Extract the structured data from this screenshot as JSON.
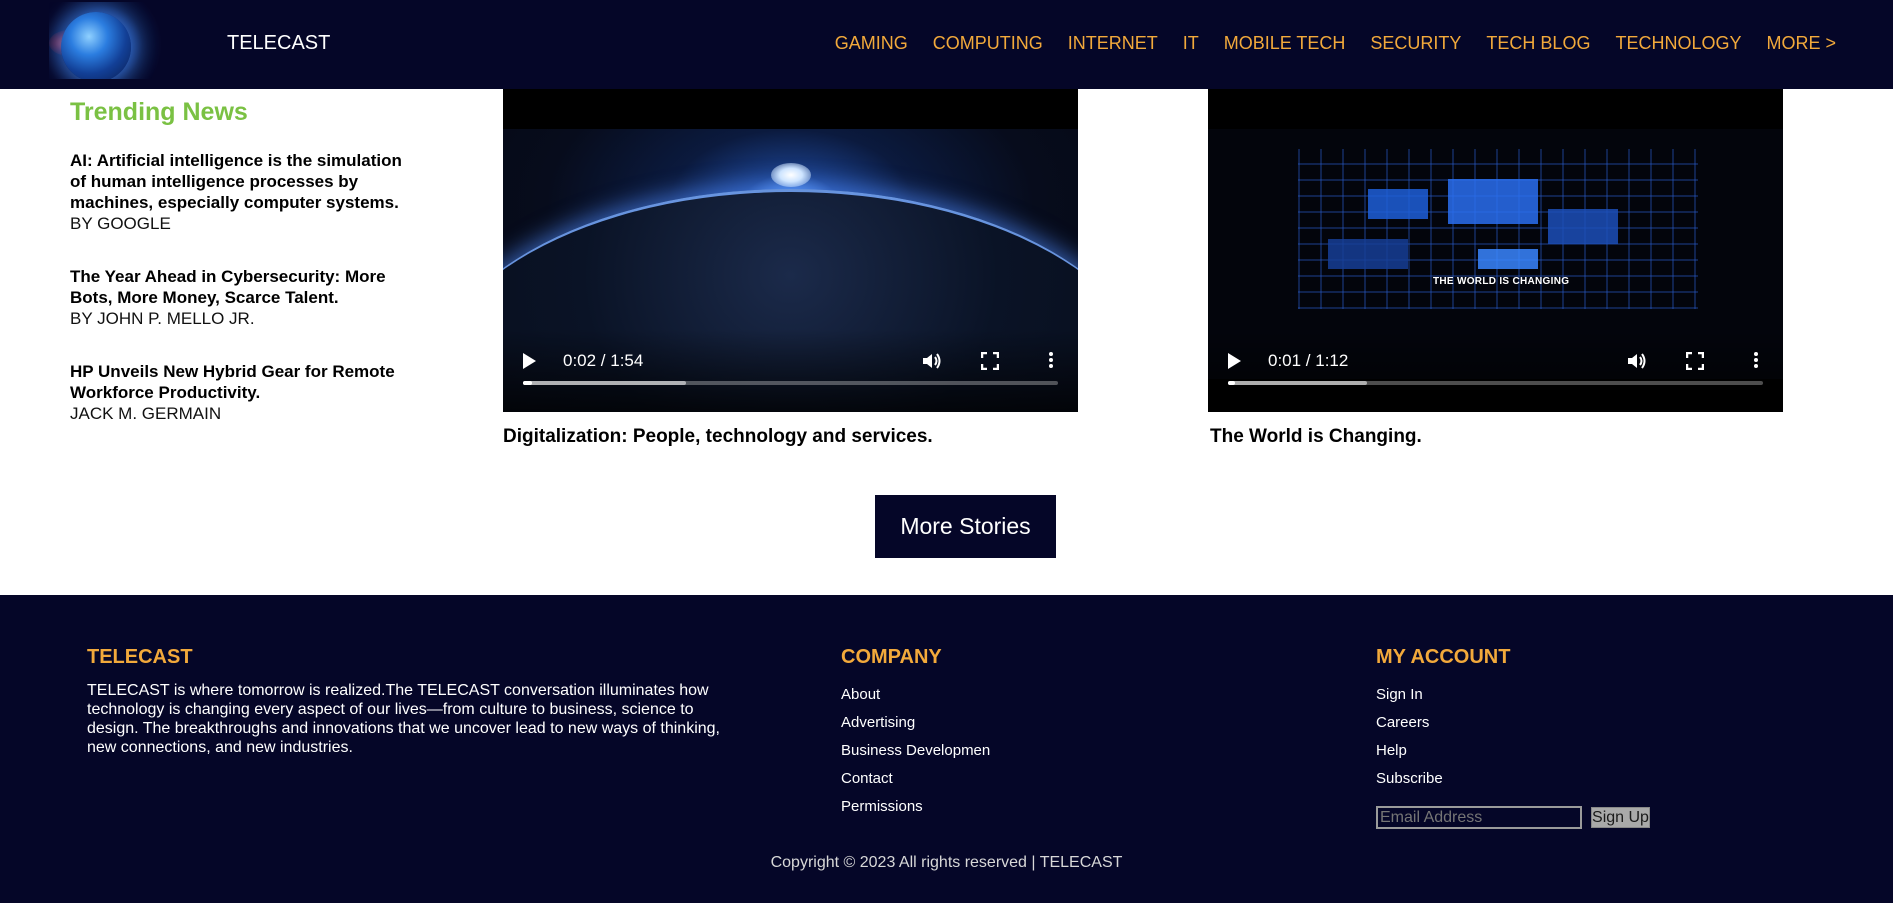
{
  "header": {
    "brand": "TELECAST",
    "nav": [
      "GAMING",
      "COMPUTING",
      "INTERNET",
      "IT",
      "MOBILE TECH",
      "SECURITY",
      "TECH BLOG",
      "TECHNOLOGY",
      "MORE >"
    ]
  },
  "trending": {
    "title": "Trending News",
    "items": [
      {
        "headline": "AI: Artificial intelligence is the simulation of human intelligence processes by machines, especially computer systems.",
        "byline": "BY GOOGLE"
      },
      {
        "headline": "The Year Ahead in Cybersecurity: More Bots, More Money, Scarce Talent.",
        "byline": "BY JOHN P. MELLO JR."
      },
      {
        "headline": "HP Unveils New Hybrid Gear for Remote Workforce Productivity.",
        "byline": "JACK M. GERMAIN"
      }
    ]
  },
  "videos": [
    {
      "time": "0:02 / 1:54",
      "title": "Digitalization: People, technology and services.",
      "progress": 0.017,
      "buffered": 0.305
    },
    {
      "time": "0:01 / 1:12",
      "title": "The World is Changing.",
      "progress": 0.014,
      "buffered": 0.26,
      "caption": "THE WORLD IS CHANGING"
    }
  ],
  "more_stories": "More Stories",
  "footer": {
    "about_title": "TELECAST",
    "about_text": "TELECAST is where tomorrow is realized.The TELECAST conversation illuminates how technology is changing every aspect of our lives—from culture to business, science to design. The breakthroughs and innovations that we uncover lead to new ways of thinking, new connections, and new industries.",
    "company_title": "COMPANY",
    "company_links": [
      "About",
      "Advertising",
      "Business Developmen",
      "Contact",
      "Permissions"
    ],
    "account_title": "MY ACCOUNT",
    "account_links": [
      "Sign In",
      "Careers",
      "Help",
      "Subscribe"
    ],
    "email_placeholder": "Email Address",
    "signup_label": "Sign Up",
    "copyright": "Copyright © 2023 All rights reserved | TELECAST"
  },
  "colors": {
    "header_bg": "#050628",
    "nav_text": "#f2a93b",
    "trending_title": "#7ac143",
    "footer_heading": "#f2a93b"
  }
}
